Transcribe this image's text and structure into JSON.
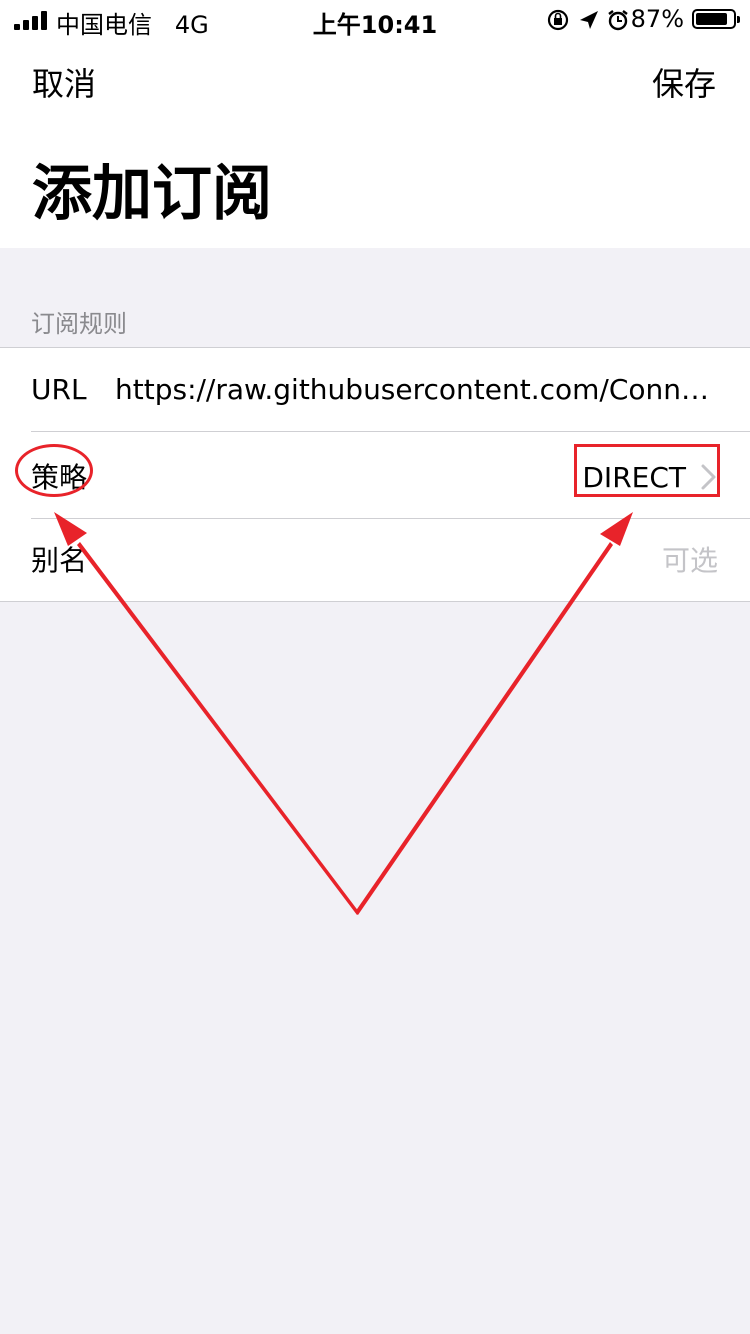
{
  "status_bar": {
    "carrier": "中国电信",
    "network": "4G",
    "time": "上午10:41",
    "battery_percent": "87%",
    "battery_level": 0.87,
    "icons": [
      "orientation-lock-icon",
      "location-arrow-icon",
      "alarm-icon"
    ]
  },
  "nav": {
    "cancel_label": "取消",
    "save_label": "保存"
  },
  "page_title": "添加订阅",
  "section": {
    "header": "订阅规则",
    "rows": [
      {
        "label": "URL",
        "value": "https://raw.githubusercontent.com/ConnersHua/Profiles/master/Surge/Ruleset/Advertising.list"
      },
      {
        "label": "策略",
        "value": "DIRECT"
      },
      {
        "label": "别名",
        "placeholder": "可选"
      }
    ]
  },
  "annotation_color": "#e8232a"
}
